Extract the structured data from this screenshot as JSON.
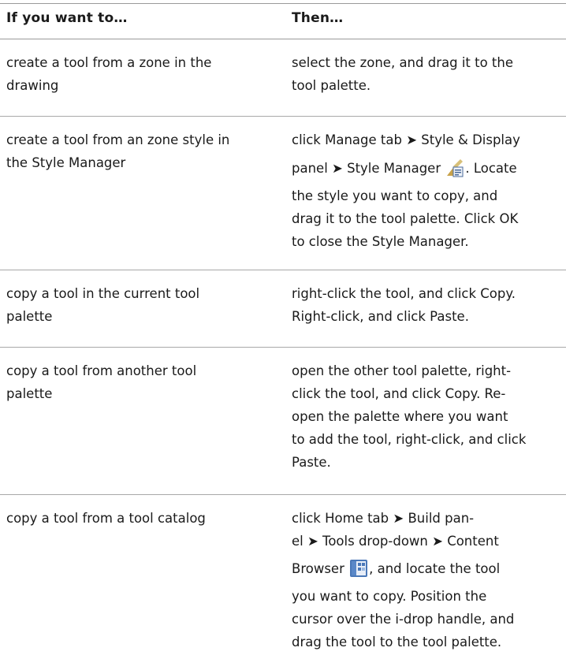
{
  "header": {
    "col1": "If you want to…",
    "col2": "Then…"
  },
  "rows": [
    {
      "col1": [
        "create a tool from a zone in the",
        "drawing"
      ],
      "col2": [
        "select the zone, and drag it to the",
        "tool palette."
      ]
    },
    {
      "col1": [
        "create a tool from an zone style in",
        "the Style Manager"
      ],
      "col2": {
        "line1": "click Manage tab ➤ Style & Display",
        "line2_before_icon": "panel ➤ Style Manager",
        "line2_after_icon": ". Locate",
        "line3": "the style you want to copy, and",
        "line4": "drag it to the tool palette. Click OK",
        "line5": "to close the Style Manager."
      },
      "icon": "style-manager-icon"
    },
    {
      "col1": [
        "copy a tool in the current tool",
        "palette"
      ],
      "col2": [
        "right-click the tool, and click Copy.",
        "Right-click, and click Paste."
      ]
    },
    {
      "col1": [
        "copy a tool from another tool",
        "palette"
      ],
      "col2": [
        "open the other tool palette, right-",
        "click the tool, and click Copy. Re-",
        "open the palette where you want",
        "to add the tool, right-click, and click",
        "Paste."
      ]
    },
    {
      "col1": [
        "copy a tool from a tool catalog"
      ],
      "col2": {
        "line1": "click Home tab ➤ Build pan-",
        "line2": "el ➤ Tools drop-down ➤ Content",
        "line3_before_icon": "Browser",
        "line3_after_icon": ", and locate the tool",
        "line4": "you want to copy. Position the",
        "line5": "cursor over the i-drop handle, and",
        "line6": "drag the tool to the tool palette."
      },
      "icon": "content-browser-icon"
    }
  ],
  "colors": {
    "rule": "#a0a0a0",
    "text": "#1a1a1a"
  }
}
